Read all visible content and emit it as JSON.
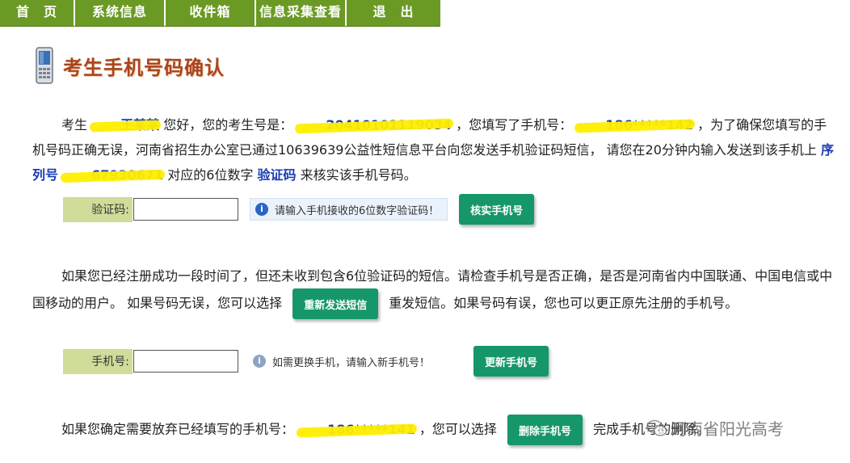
{
  "nav": {
    "items": [
      {
        "label": "首　页",
        "width": 93
      },
      {
        "label": "系统信息",
        "width": 112
      },
      {
        "label": "收件箱",
        "width": 112
      },
      {
        "label": "信息采集查看",
        "width": 112
      },
      {
        "label": "退　出",
        "width": 116
      }
    ]
  },
  "header": {
    "title": "考生手机号码确认"
  },
  "section1": {
    "greet": "考生",
    "name": "王某某",
    "t1": "您好，您的考生号是：",
    "exam_no": "20410101119034",
    "t2": "，您填写了手机号：",
    "phone": "186*****142",
    "t3": "，为了确保您填写的手机号码正确无误，河南省招生办公室已通过10639639公益性短信息平台向您发送手机验证码短信， 请您在20分钟内输入发送到该手机上",
    "seq_label": "序列号",
    "seq_no": "67930671",
    "t4": "对应的6位数字",
    "code_label": "验证码",
    "t5": "来核实该手机号码。"
  },
  "verify": {
    "label": "验证码:",
    "input_value": "",
    "hint": "请输入手机接收的6位数字验证码！",
    "button": "核实手机号"
  },
  "section2": {
    "t1": "如果您已经注册成功一段时间了，但还未收到包含6位验证码的短信。请检查手机号是否正确，是否是河南省内中国联通、中国电信或中国移动的用户。 如果号码无误，您可以选择",
    "resend_button": "重新发送短信",
    "t2": "重发短信。如果号码有误，您也可以更正原先注册的手机号。"
  },
  "update": {
    "label": "手机号:",
    "input_value": "",
    "hint": "如需更换手机，请输入新手机号！",
    "button": "更新手机号"
  },
  "section3": {
    "t1": "如果您确定需要放弃已经填写的手机号：",
    "phone": "186*****141",
    "t2": "，您可以选择",
    "delete_button": "删除手机号",
    "t3": "完成手机号的删除。"
  },
  "watermark": {
    "text": "河南省阳光高考"
  }
}
